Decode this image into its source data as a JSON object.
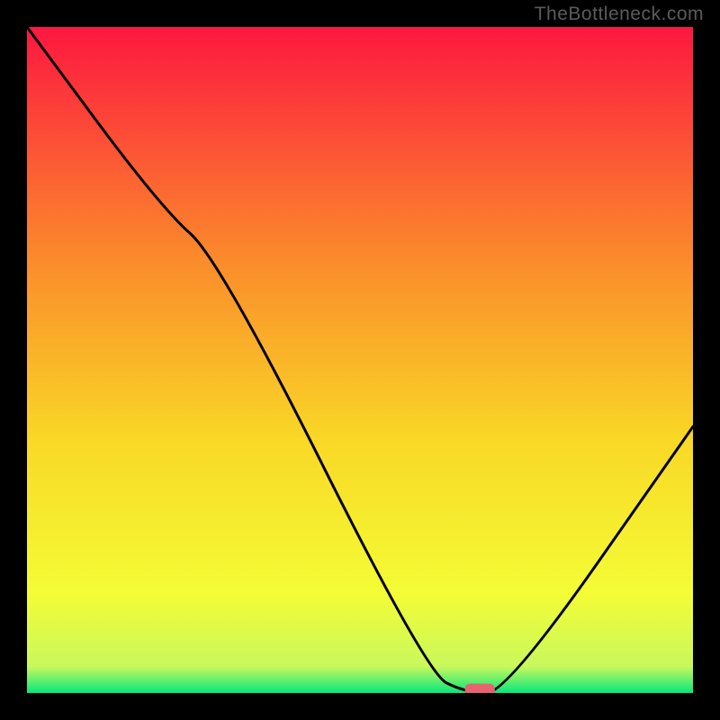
{
  "watermark": "TheBottleneck.com",
  "chart_data": {
    "type": "line",
    "title": "",
    "xlabel": "",
    "ylabel": "",
    "xlim": [
      0,
      100
    ],
    "ylim": [
      0,
      100
    ],
    "gradient_colors": {
      "top": "#fd1740",
      "upper_mid": "#fb8b2b",
      "mid": "#f9d826",
      "lower_mid": "#f4fc35",
      "bottom": "#06e77d"
    },
    "series": [
      {
        "name": "bottleneck-curve",
        "color": "#000000",
        "x": [
          0,
          20,
          29,
          60,
          66,
          72,
          100
        ],
        "y": [
          100,
          73,
          65,
          3,
          0,
          0,
          40
        ]
      }
    ],
    "marker": {
      "name": "optimal-point",
      "x": 68,
      "y": 0.5,
      "color": "#e9626f",
      "width_pct": 4.5,
      "height_pct": 1.8
    }
  }
}
